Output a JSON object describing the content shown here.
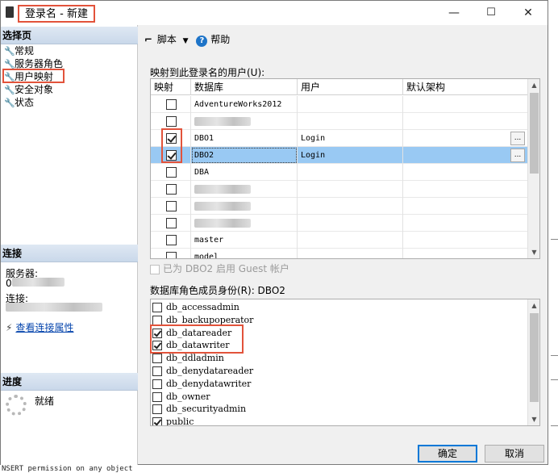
{
  "window": {
    "title": "登录名 - 新建",
    "controls": {
      "minimize": "—",
      "maximize": "☐",
      "close": "✕"
    }
  },
  "left_panel": {
    "select_page_header": "选择页",
    "pages": [
      "常规",
      "服务器角色",
      "用户映射",
      "安全对象",
      "状态"
    ],
    "connection_header": "连接",
    "server_label": "服务器:",
    "server_value": "0",
    "connection_label": "连接:",
    "view_connection_props": "查看连接属性",
    "progress_header": "进度",
    "progress_status": "就绪"
  },
  "toolbar": {
    "script_label": "脚本",
    "help_label": "帮助"
  },
  "mapping": {
    "label": "映射到此登录名的用户(U):",
    "columns": [
      "映射",
      "数据库",
      "用户",
      "默认架构"
    ],
    "rows": [
      {
        "checked": false,
        "db": "AdventureWorks2012",
        "user": "",
        "schema": "",
        "selected": false,
        "ellipsis": false
      },
      {
        "checked": false,
        "db": "",
        "user": "",
        "schema": "",
        "selected": false,
        "ellipsis": false,
        "blurred": true
      },
      {
        "checked": true,
        "db": "DBO1",
        "user": "Login",
        "schema": "",
        "selected": false,
        "ellipsis": true
      },
      {
        "checked": true,
        "db": "DBO2",
        "user": "Login",
        "schema": "",
        "selected": true,
        "ellipsis": true
      },
      {
        "checked": false,
        "db": "DBA",
        "user": "",
        "schema": "",
        "selected": false,
        "ellipsis": false
      },
      {
        "checked": false,
        "db": "",
        "user": "",
        "schema": "",
        "selected": false,
        "ellipsis": false,
        "blurred": true
      },
      {
        "checked": false,
        "db": "",
        "user": "",
        "schema": "",
        "selected": false,
        "ellipsis": false,
        "blurred": true
      },
      {
        "checked": false,
        "db": "",
        "user": "",
        "schema": "",
        "selected": false,
        "ellipsis": false,
        "blurred": true
      },
      {
        "checked": false,
        "db": "master",
        "user": "",
        "schema": "",
        "selected": false,
        "ellipsis": false
      },
      {
        "checked": false,
        "db": "model",
        "user": "",
        "schema": "",
        "selected": false,
        "ellipsis": false
      }
    ],
    "ellipsis_label": "...",
    "guest_label": "已为 DBO2 启用 Guest 帐户"
  },
  "roles": {
    "label": "数据库角色成员身份(R): DBO2",
    "items": [
      {
        "name": "db_accessadmin",
        "checked": false
      },
      {
        "name": "db_backupoperator",
        "checked": false
      },
      {
        "name": "db_datareader",
        "checked": true
      },
      {
        "name": "db_datawriter",
        "checked": true
      },
      {
        "name": "db_ddladmin",
        "checked": false
      },
      {
        "name": "db_denydatareader",
        "checked": false
      },
      {
        "name": "db_denydatawriter",
        "checked": false
      },
      {
        "name": "db_owner",
        "checked": false
      },
      {
        "name": "db_securityadmin",
        "checked": false
      },
      {
        "name": "public",
        "checked": true
      }
    ]
  },
  "buttons": {
    "ok": "确定",
    "cancel": "取消"
  },
  "background_text": "NSERT permission on any object",
  "colors": {
    "highlight_red": "#e2533b",
    "selection_blue": "#99c9f3"
  }
}
